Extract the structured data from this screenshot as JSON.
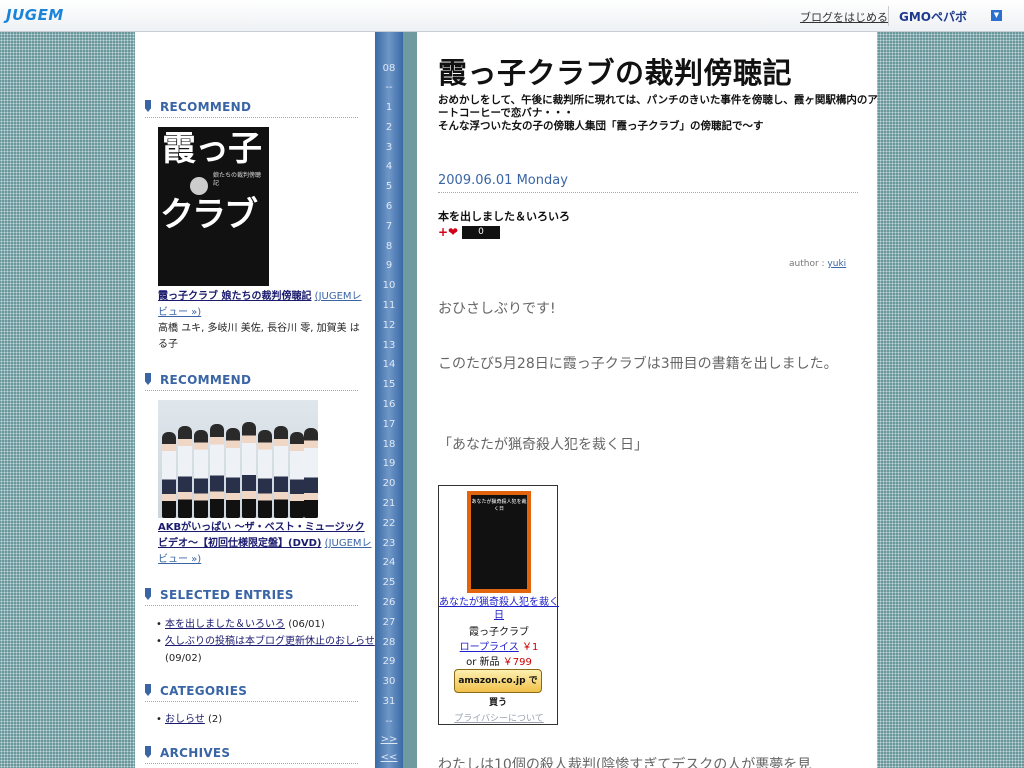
{
  "topbar": {
    "logo": "JUGEM",
    "start_blog": "ブログをはじめる",
    "gmo_logo": "GMOペパボ",
    "menu_icon": "▼"
  },
  "sidebar": {
    "recommend1": {
      "heading": "RECOMMEND",
      "cover_line1": "霞っ子",
      "cover_line2": "クラブ",
      "cover_sub": "娘たちの裁判傍聴記",
      "title_link": "霞っ子クラブ 娘たちの裁判傍聴記",
      "review_link": "(JUGEMレビュー »)",
      "authors": "高橋 ユキ, 多岐川 美佐, 長谷川 零, 加賀美 はる子"
    },
    "recommend2": {
      "heading": "RECOMMEND",
      "title_link": "AKBがいっぱい ～ザ・ベスト・ミュージックビデオ～【初回仕様限定盤】(DVD)",
      "review_link": "(JUGEMレビュー »)"
    },
    "selected_entries": {
      "heading": "SELECTED ENTRIES",
      "items": [
        {
          "title": "本を出しました＆いろいろ",
          "date": "(06/01)"
        },
        {
          "title": "久しぶりの投稿は本ブログ更新休止のおしらせ",
          "date": "(09/02)"
        }
      ]
    },
    "categories": {
      "heading": "CATEGORIES",
      "items": [
        {
          "title": "おしらせ",
          "count": "(2)"
        }
      ]
    },
    "archives": {
      "heading": "ARCHIVES"
    }
  },
  "calendar": {
    "month": "08",
    "dash": "--",
    "days": [
      "1",
      "2",
      "3",
      "4",
      "5",
      "6",
      "7",
      "8",
      "9",
      "10",
      "11",
      "12",
      "13",
      "14",
      "15",
      "16",
      "17",
      "18",
      "19",
      "20",
      "21",
      "22",
      "23",
      "24",
      "25",
      "26",
      "27",
      "28",
      "29",
      "30",
      "31"
    ],
    "dash_end": "--",
    "next": ">>",
    "prev": "<<"
  },
  "main": {
    "blog_title": "霞っ子クラブの裁判傍聴記",
    "blog_desc_line1": "おめかしをして、午後に裁判所に現れては、パンチのきいた事件を傍聴し、霞ヶ関駅構内のアートコーヒーで恋バナ・・・",
    "blog_desc_line2": "そんな浮ついた女の子の傍聴人集団「霞っ子クラブ」の傍聴記で～す",
    "entry_date": "2009.06.01 Monday",
    "entry_title": "本を出しました＆いろいろ",
    "plus_heart": "+❤",
    "heart_count": "0",
    "author_label": "author : ",
    "author_name": "yuki",
    "paragraph1": "おひさしぶりです!",
    "paragraph2": "このたび5月28日に霞っ子クラブは3冊目の書籍を出しました。",
    "paragraph3": "「あなたが猟奇殺人犯を裁く日」",
    "paragraph4": "わたしは10個の殺人裁判(陰惨すぎてデスクの人が悪夢を見"
  },
  "amazon": {
    "cover_text": "あなたが猟奇殺人犯を裁く日",
    "title": "あなたが猟奇殺人犯を裁く日",
    "author": "霞っ子クラブ",
    "low_price_label": "ロープライス",
    "low_price": "￥1",
    "new_label": "or 新品",
    "new_price": "￥799",
    "button_label": "amazon.co.jp で買う",
    "privacy": "プライバシーについて"
  }
}
